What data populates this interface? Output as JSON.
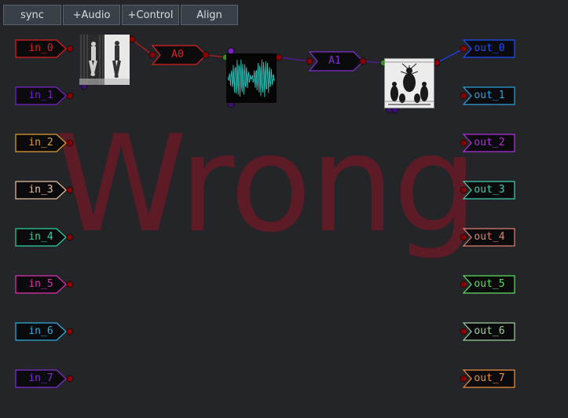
{
  "toolbar": {
    "buttons": [
      {
        "label": "sync"
      },
      {
        "label": "+Audio"
      },
      {
        "label": "+Control"
      },
      {
        "label": "Align"
      }
    ]
  },
  "watermark": "Wrong",
  "inputs": [
    {
      "label": "in_0",
      "color": "#e02020"
    },
    {
      "label": "in_1",
      "color": "#7a20c8"
    },
    {
      "label": "in_2",
      "color": "#e0a030"
    },
    {
      "label": "in_3",
      "color": "#e8c0a0"
    },
    {
      "label": "in_4",
      "color": "#30d0a0"
    },
    {
      "label": "in_5",
      "color": "#e030b0"
    },
    {
      "label": "in_6",
      "color": "#30b0e0"
    },
    {
      "label": "in_7",
      "color": "#8030d0"
    }
  ],
  "outputs": [
    {
      "label": "out_0",
      "color": "#2050ff"
    },
    {
      "label": "out_1",
      "color": "#30a0e0"
    },
    {
      "label": "out_2",
      "color": "#b030e0"
    },
    {
      "label": "out_3",
      "color": "#40d0b0"
    },
    {
      "label": "out_4",
      "color": "#e08070"
    },
    {
      "label": "out_5",
      "color": "#60e060"
    },
    {
      "label": "out_6",
      "color": "#a0d0a0"
    },
    {
      "label": "out_7",
      "color": "#f09040"
    }
  ],
  "nodes": {
    "a0": {
      "label": "A0",
      "color": "#e02020"
    },
    "a1": {
      "label": "A1",
      "color": "#8030d0"
    }
  }
}
